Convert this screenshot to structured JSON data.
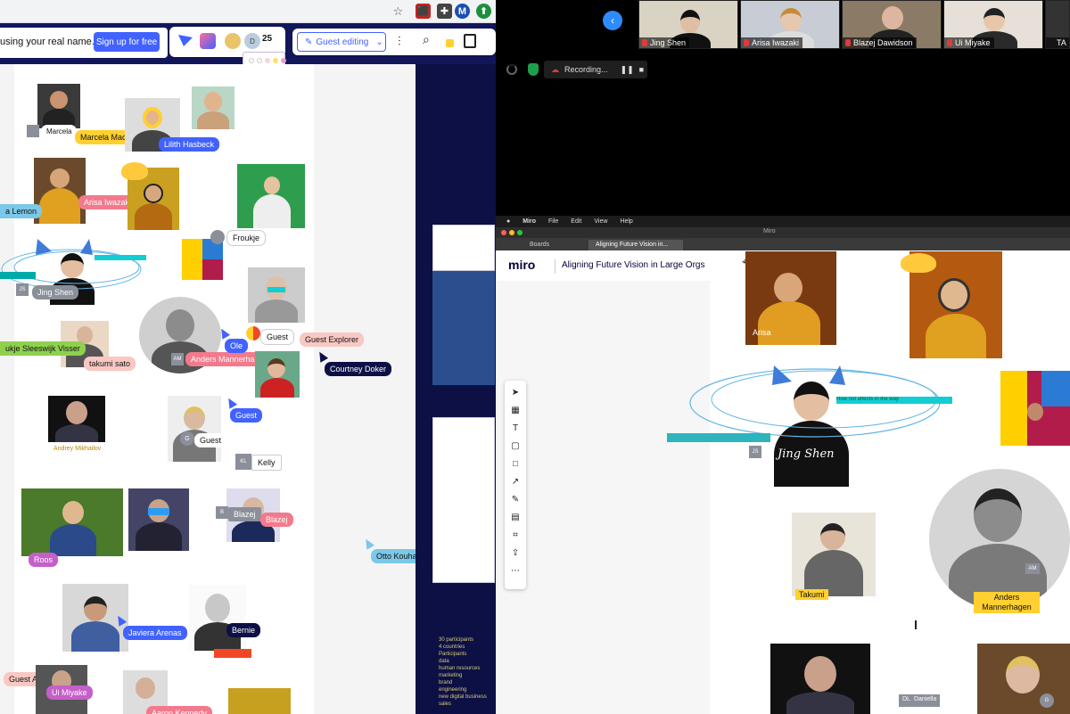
{
  "browser": {
    "icons": [
      "star-icon",
      "pdf-icon",
      "extension-icon",
      "puzzle-icon",
      "profile-M",
      "sync-icon"
    ],
    "avatar_letter": "M"
  },
  "left_board": {
    "signup_prompt": "using your real name.",
    "signup_button": "Sign up for free",
    "collaborator_count": "25",
    "collaborator_letter": "D",
    "guest_editing": "Guest editing",
    "colors": {
      "banner": "#12175c",
      "accent": "#4262ff"
    },
    "people": [
      {
        "name": "Marcela",
        "tag": "Marcela Machuca",
        "tag_color": "#ffd02f"
      },
      {
        "name": "Lilith Hasbeck",
        "tag_color": "#4262ff"
      },
      {
        "name": "Arisa Iwazaki",
        "tag_color": "#f27a8c"
      },
      {
        "name": "Froukje"
      },
      {
        "name": "Jing Shen",
        "initials": "JS"
      },
      {
        "name": "takumi sato"
      },
      {
        "name": "Anders Mannerhagen",
        "initials": "AM",
        "tag_color": "#f27a8c"
      },
      {
        "name": "Ole",
        "tag_color": "#4262ff"
      },
      {
        "name": "Guest"
      },
      {
        "name": "Guest Explorer",
        "tag_color": "#f9c8c3"
      },
      {
        "name": "Courtney Doker",
        "tag_color": "#0d1044"
      },
      {
        "name": "Andrey Mikhailov"
      },
      {
        "name": "Guest",
        "initials": "G"
      },
      {
        "name": "Kelly",
        "initials": "KL"
      },
      {
        "name": "Roos",
        "tag_color": "#c55fc9"
      },
      {
        "name": "Blazej",
        "initials": "B"
      },
      {
        "name": "Otto Kouhanen",
        "tag_color": "#7bc8e8"
      },
      {
        "name": "Javiera Arenas",
        "tag_color": "#4262ff"
      },
      {
        "name": "Bernie",
        "tag_color": "#0d1044"
      },
      {
        "name": "Guest Artisan",
        "tag_color": "#f9c8c3"
      },
      {
        "name": "Ui Miyake",
        "tag_color": "#c55fc9"
      },
      {
        "name": "Aaron Kennedy",
        "tag_color": "#f27a8c"
      },
      {
        "name": "Lemon",
        "tag": "a Lemon",
        "tag_color": "#7bc8e8"
      },
      {
        "name": "Sleeswijk Visser",
        "tag": "ukje Sleeswijk Visser",
        "tag_color": "#8fd14f"
      }
    ],
    "side_text_lines": [
      "30 participants",
      "4 countries",
      "Participants",
      "data",
      "human resources",
      "marketing",
      "brand",
      "engineering",
      "new digital business",
      "sales"
    ]
  },
  "meeting": {
    "participants": [
      "Jing Shen",
      "Arisa Iwazaki",
      "Blazej Dawidson",
      "Ui Miyake",
      "TA"
    ],
    "recording_label": "Recording...",
    "colors": {
      "mic": "#e03a3a",
      "back_button": "#2d8cff"
    }
  },
  "app": {
    "menu": [
      "Miro",
      "File",
      "Edit",
      "View",
      "Help"
    ],
    "window_title": "Miro",
    "tabs": [
      "Boards",
      "Aligning Future Vision in..."
    ],
    "logo": "miro",
    "board_title": "Aligning Future Vision in Large Orgs",
    "tools": [
      "cursor-icon",
      "frame-icon",
      "text-icon",
      "sticky-note-icon",
      "shape-icon",
      "line-icon",
      "pen-icon",
      "comment-icon",
      "crop-icon",
      "upload-icon",
      "more-icon"
    ],
    "labels": {
      "arisa": "Arisa",
      "jing": "Jing Shen",
      "jing_initials": "JS",
      "takumi": "Takumi",
      "anders": "Anders Mannerhagen",
      "anders_initials": "AM",
      "guest_initials": "G",
      "daniella": "Daniella",
      "daniella_initials": "DL"
    },
    "annotation": "How not affects in the way"
  }
}
